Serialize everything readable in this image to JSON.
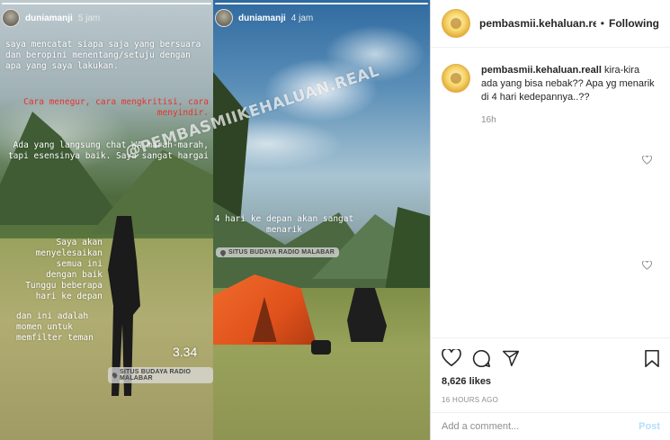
{
  "stories": [
    {
      "username": "duniamanji",
      "time": "5 jam",
      "texts": [
        "saya mencatat siapa saja yang bersuara dan beropini menentang/setuju dengan apa yang saya lakukan.",
        "Cara menegur, cara mengkritisi, cara menyindir.",
        "Ada yang langsung chat WA marah-marah, tapi esensinya baik. Saya sangat hargai",
        "Saya akan menyelesaikan semua ini dengan baik Tunggu beberapa hari ke depan",
        "dan ini adalah momen untuk memfilter teman"
      ],
      "time_sticker": "3.34",
      "location": "SITUS BUDAYA RADIO MALABAR"
    },
    {
      "username": "duniamanji",
      "time": "4 jam",
      "texts": [
        "4 hari ke depan akan sangat menarik"
      ],
      "location": "SITUS BUDAYA RADIO MALABAR"
    }
  ],
  "watermark": "@PEMBASMIIKEHALUAN.REAL",
  "post": {
    "username": "pembasmii.kehaluan.re",
    "separator": "•",
    "follow_label": "Following",
    "caption_user": "pembasmii.kehaluan.reall",
    "caption_text": "kira-kira ada yang bisa nebak?? Apa yg menarik di 4 hari kedepannya..??",
    "caption_time": "16h",
    "likes": "8,626 likes",
    "posted_ago": "16 HOURS AGO",
    "comment_placeholder": "Add a comment...",
    "post_label": "Post"
  },
  "icons": {
    "like": "heart-icon",
    "comment": "comment-icon",
    "share": "share-icon",
    "save": "bookmark-icon",
    "comment_like": "heart-small-icon"
  }
}
